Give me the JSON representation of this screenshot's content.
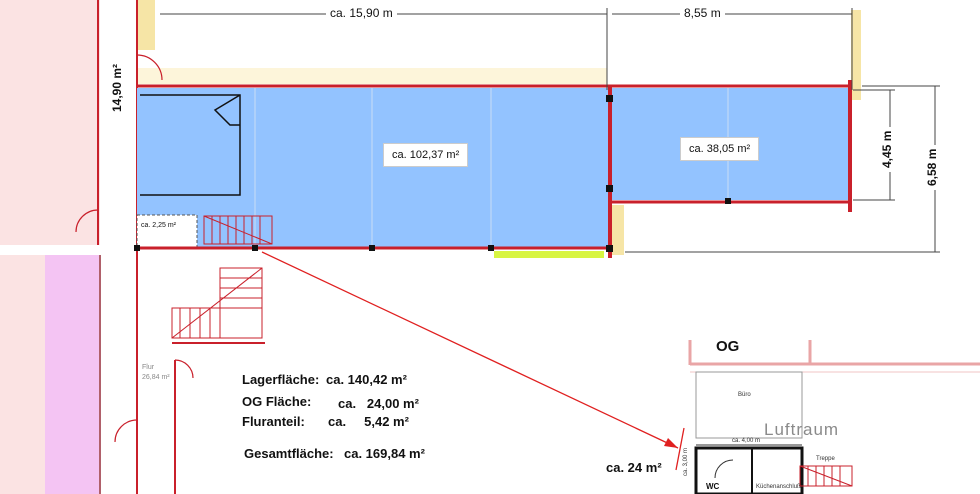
{
  "dimensions": {
    "length_main": "ca. 15,90 m",
    "length_side": "8,55 m",
    "height_inner": "4,45 m",
    "height_outer": "6,58 m"
  },
  "rooms": {
    "left_room_area": "14,90 m²",
    "main_area": "ca. 102,37 m²",
    "side_area": "ca. 38,05 m²",
    "small_area": "ca. 2,25 m²",
    "flur_label": "Flur",
    "flur_area": "26,84 m²"
  },
  "summary": {
    "lager_label": "Lagerfläche:",
    "lager_value": "ca. 140,42 m²",
    "og_label": "OG Fläche:",
    "og_value": "ca.   24,00 m²",
    "flur_label": "Fluranteil:",
    "flur_value": "ca.     5,42 m²",
    "gesamt_label": "Gesamtfläche:",
    "gesamt_value": "ca. 169,84 m²"
  },
  "og_plan": {
    "title": "OG",
    "buero": "Büro",
    "luftraum": "Luftraum",
    "width_dim": "ca. 4,00 m",
    "side_dim": "ca. 3,00 m",
    "treppe": "Treppe",
    "wc": "WC",
    "kueche": "Küchenanschluß",
    "area_callout": "ca. 24 m²"
  },
  "colors": {
    "room_fill": "#93c3ff",
    "wall": "#c9202b",
    "wall_light": "#e9a5a6",
    "beige": "#f6e5a6",
    "pink": "#f4c4f3",
    "lime": "#d8f542",
    "arrow": "#e02020"
  }
}
